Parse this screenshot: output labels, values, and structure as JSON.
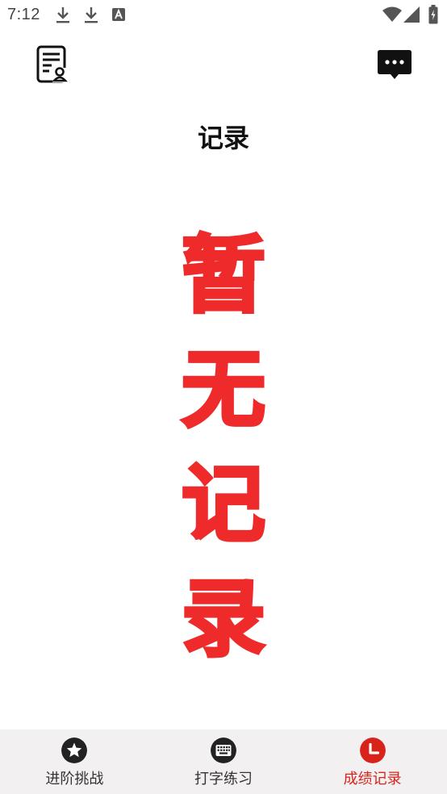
{
  "status_bar": {
    "time": "7:12",
    "icons": [
      "download-icon",
      "download-icon",
      "font-a-icon",
      "wifi-icon",
      "signal-icon",
      "battery-charging-icon"
    ]
  },
  "header": {
    "title": "记录",
    "left_icon": "report-document-icon",
    "right_icon": "chat-bubble-icon"
  },
  "empty_state": {
    "chars": [
      "暂",
      "无",
      "记",
      "录"
    ]
  },
  "bottom_nav": {
    "items": [
      {
        "label": "进阶挑战",
        "icon": "star-icon",
        "active": false
      },
      {
        "label": "打字练习",
        "icon": "keyboard-icon",
        "active": false
      },
      {
        "label": "成绩记录",
        "icon": "clock-icon",
        "active": true
      }
    ]
  },
  "colors": {
    "accent": "#d8231b",
    "empty_text": "#ee2a2a",
    "nav_background": "#f3f0f1",
    "icon_dark": "#222222"
  }
}
